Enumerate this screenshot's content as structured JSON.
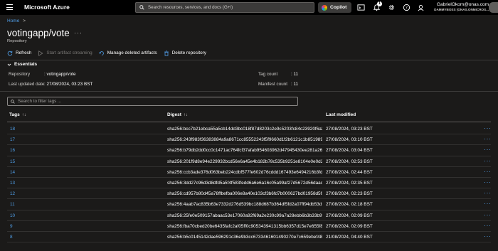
{
  "topbar": {
    "brand": "Microsoft Azure",
    "search_placeholder": "Search resources, services, and docs (G+/)",
    "copilot_label": "Copilot",
    "notification_count": "1",
    "user_name": "GabrielOkom@onas.com",
    "user_tenant": "DAMMYBOSS (ONAS.ONMICROS..."
  },
  "breadcrumb": {
    "home": "Home",
    "sep": ">"
  },
  "page": {
    "title": "votingapp/vote",
    "more": "···",
    "subtitle": "Repository"
  },
  "toolbar": {
    "refresh": "Refresh",
    "start_streaming": "Start artifact streaming",
    "manage_deleted": "Manage deleted artifacts",
    "delete_repo": "Delete repository"
  },
  "essentials": {
    "header": "Essentials",
    "repository_label": "Repository",
    "repository_value": ": votingapp/vote",
    "last_updated_label": "Last updated date",
    "last_updated_value": ": 27/08/2024, 03:23 BST",
    "tag_count_label": "Tag count",
    "tag_count_value": ": 11",
    "manifest_count_label": "Manifest count",
    "manifest_count_value": ": 11"
  },
  "filter": {
    "placeholder": "Search to filter tags ..."
  },
  "table": {
    "headers": {
      "tags": "Tags",
      "digest": "Digest",
      "last_modified": "Last modified"
    },
    "sort_icon": "↑↓",
    "row_more": "···",
    "rows": [
      {
        "tag": "18",
        "digest": "sha256:bcc7b21ebca55a5cb14dd3bc018f87d8203c2e9c5203fc84c23920f6a2...",
        "modified": "27/08/2024, 03:23 BST"
      },
      {
        "tag": "17",
        "digest": "sha256:243f983f36383884a9a8671cc85552243f5f9660d1f2b6121c1b851989...",
        "modified": "27/08/2024, 03:10 BST"
      },
      {
        "tag": "16",
        "digest": "sha256:b79db2dd0cc0c1471ac764fcf37afab954603962d47945430ee281a267...",
        "modified": "27/08/2024, 03:04 BST"
      },
      {
        "tag": "15",
        "digest": "sha256:201f9d8e94e229932bcd56e6a45e4b182b78c535b9251e8104e0e0d2...",
        "modified": "27/08/2024, 02:53 BST"
      },
      {
        "tag": "14",
        "digest": "sha256:ccb3ade376d063beb224cdbf577fe602d76cddd167493e6494216b3fd...",
        "modified": "27/08/2024, 02:44 BST"
      },
      {
        "tag": "13",
        "digest": "sha256:3dd27c96d3d8dfd5a5f4f583fedd6a6e6a16c05a99af27d5672d56daac...",
        "modified": "27/08/2024, 02:35 BST"
      },
      {
        "tag": "12",
        "digest": "sha256:cd957b80d45a78ffbefba006e8a40e103cf3b6fd7b000627bd01958d5fa...",
        "modified": "27/08/2024, 02:23 BST"
      },
      {
        "tag": "11",
        "digest": "sha256:4aab7ac835b63e7332d276d539bc188d687b364df5fd2a07ff94db53d...",
        "modified": "27/08/2024, 02:18 BST"
      },
      {
        "tag": "10",
        "digest": "sha256:25fe0e509157abaac53e17060a92f69a2e230c99a7a28ebb6b3b33b9f...",
        "modified": "27/08/2024, 02:09 BST"
      },
      {
        "tag": "9",
        "digest": "sha256:fba70cbed20be6435fafc2af05ff0c905343941315bb6357d15e7e655f8...",
        "modified": "27/08/2024, 02:09 BST"
      },
      {
        "tag": "8",
        "digest": "sha256:b5c0145142dae596291c36e9b3cc6733461601490270e7c659ebef48a...",
        "modified": "21/08/2024, 04:40 BST"
      }
    ]
  },
  "colors": {
    "accent_link": "#4f9de6",
    "background": "#1b1a19",
    "topbar": "#000000"
  }
}
